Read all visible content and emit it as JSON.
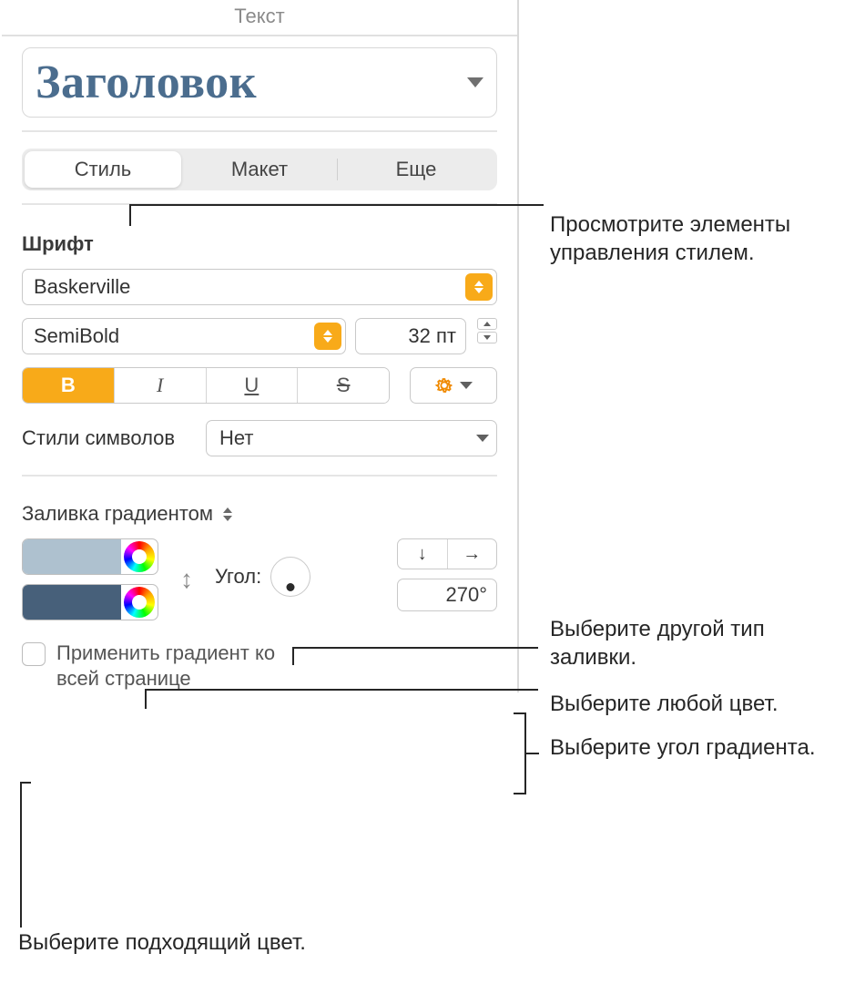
{
  "panel": {
    "title": "Текст"
  },
  "style_picker": {
    "title": "Заголовок"
  },
  "tabs": {
    "style": "Стиль",
    "layout": "Макет",
    "more": "Еще"
  },
  "font": {
    "section": "Шрифт",
    "family": "Baskerville",
    "weight": "SemiBold",
    "size": "32 пт"
  },
  "char_styles": {
    "label": "Стили символов",
    "value": "Нет"
  },
  "fill": {
    "type": "Заливка градиентом",
    "angle_label": "Угол:",
    "angle_value": "270°",
    "apply": "Применить градиент ко всей странице",
    "color1": "#aec1cf",
    "color2": "#47607a"
  },
  "callouts": {
    "c1": "Просмотрите элементы управления стилем.",
    "c2": "Выберите другой тип заливки.",
    "c3": "Выберите любой цвет.",
    "c4": "Выберите угол градиента.",
    "c5": "Выберите подходящий цвет."
  }
}
